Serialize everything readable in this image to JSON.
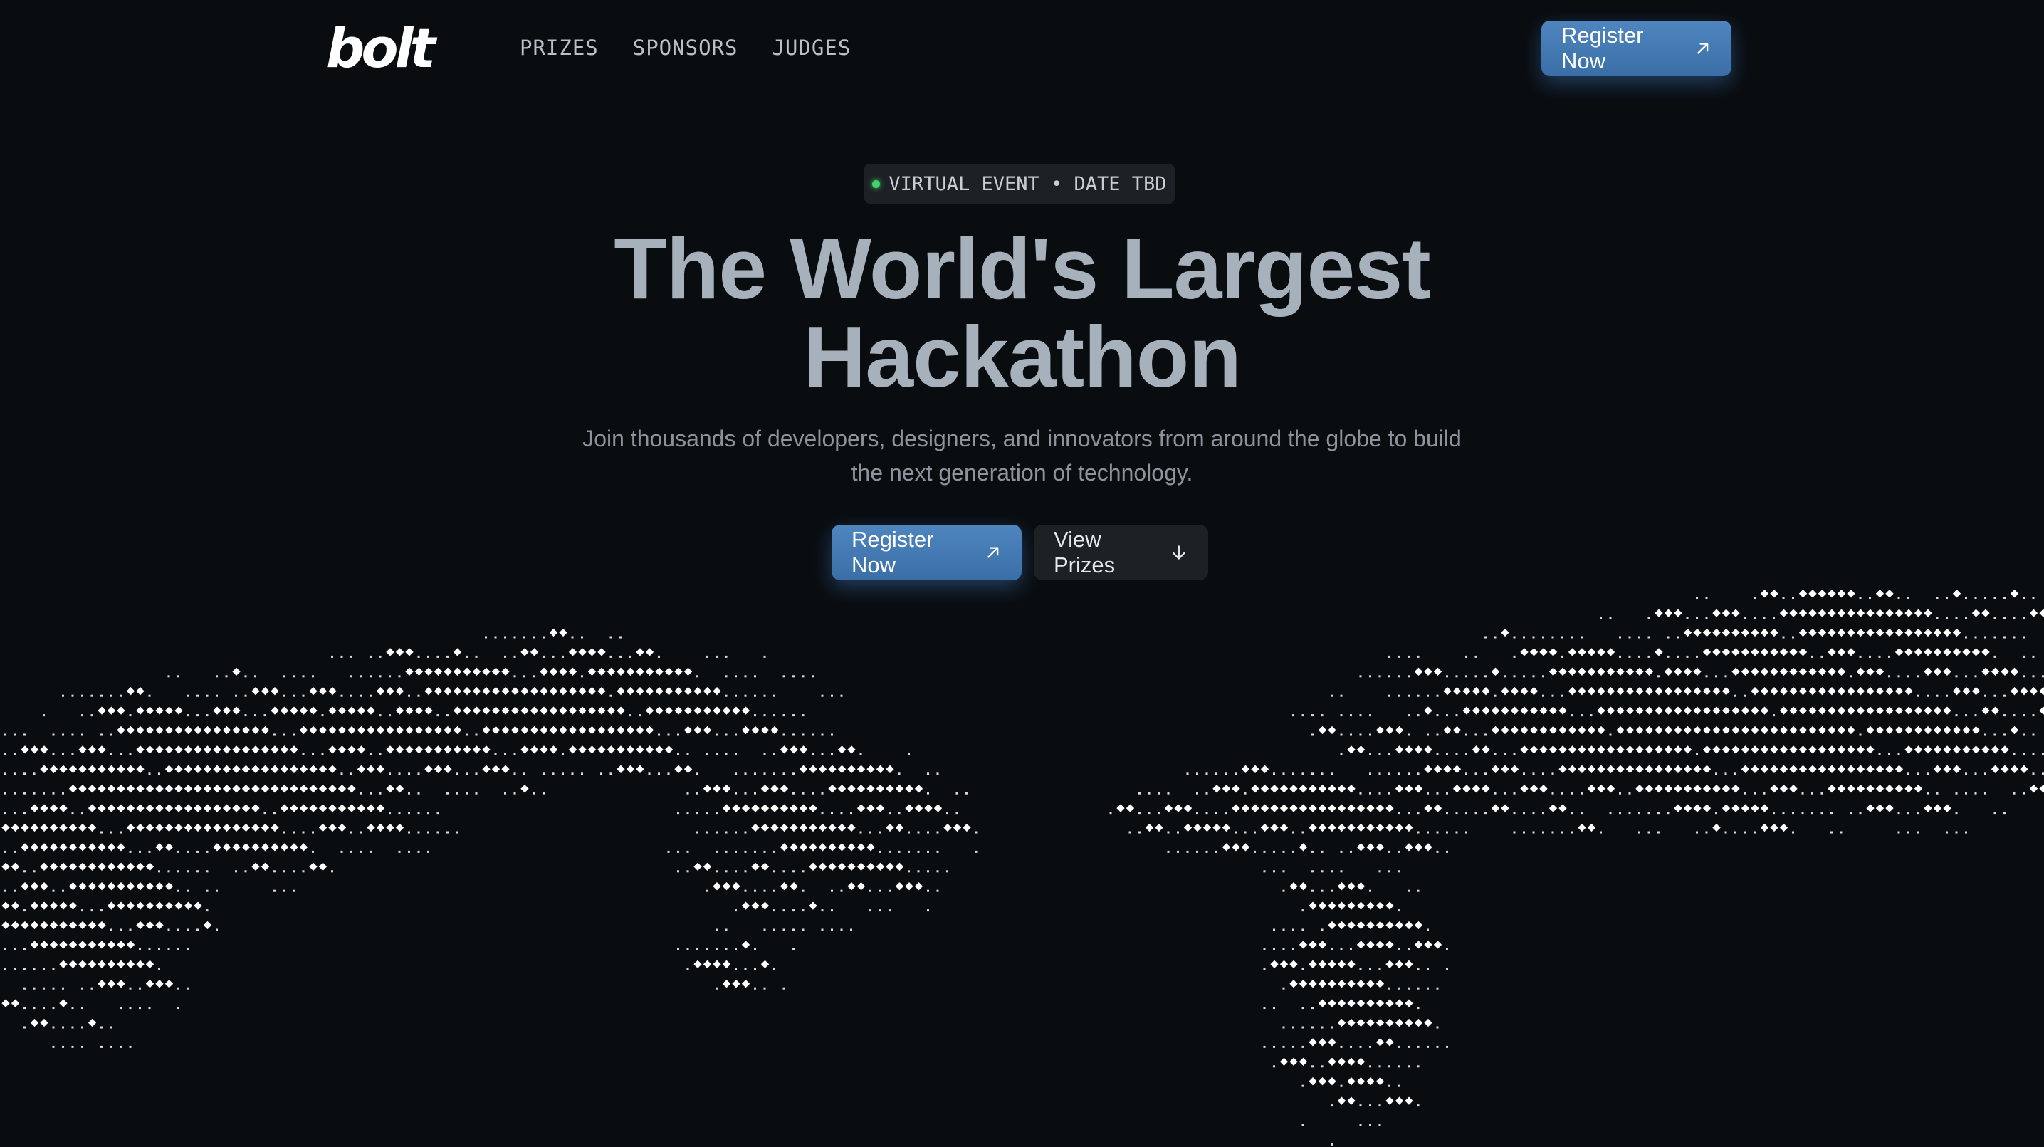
{
  "nav": {
    "logo": "bolt",
    "links": [
      "PRIZES",
      "SPONSORS",
      "JUDGES"
    ],
    "cta_label": "Register Now"
  },
  "hero": {
    "badge": "VIRTUAL EVENT • DATE TBD",
    "title_line1": "The World's Largest",
    "title_line2": "Hackathon",
    "subtitle": "Join thousands of developers, designers, and innovators from around the globe to build the next generation of technology.",
    "primary_cta": "Register Now",
    "secondary_cta": "View Prizes"
  },
  "icons": {
    "register": "arrow-up-right-icon",
    "prizes": "arrow-down-icon",
    "status": "green-dot-icon"
  },
  "colors": {
    "background": "#0a0d10",
    "accent": "#4a7fb8",
    "title": "#a7b1bb",
    "status_dot": "#43d36a"
  }
}
